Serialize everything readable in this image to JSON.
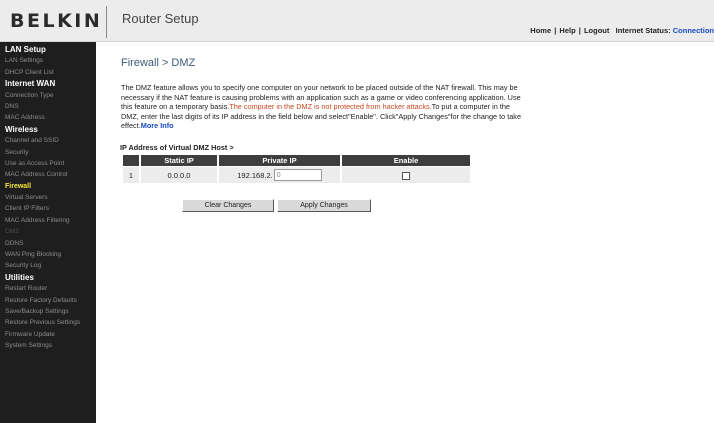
{
  "header": {
    "logo": "BELKIN",
    "title": "Router Setup",
    "links": [
      {
        "label": "Home"
      },
      {
        "label": "Help"
      },
      {
        "label": "Logout"
      }
    ],
    "status_label": "Internet Status:",
    "status_value": "Connection"
  },
  "sidebar": {
    "sections": [
      {
        "title": "LAN Setup",
        "items": [
          "LAN Settings",
          "DHCP Client List"
        ]
      },
      {
        "title": "Internet WAN",
        "items": [
          "Connection Type",
          "DNS",
          "MAC Address"
        ]
      },
      {
        "title": "Wireless",
        "items": [
          "Channel and SSID",
          "Security",
          "Use as Access Point",
          "MAC Address Control"
        ]
      },
      {
        "title": "Firewall",
        "items": [
          "Virtual Servers",
          "Client IP Filters",
          "MAC Address Filtering",
          "DMZ",
          "DDNS",
          "WAN Ping Blocking",
          "Security Log"
        ]
      },
      {
        "title": "Utilities",
        "items": [
          "Restart Router",
          "Restore Factory Defaults",
          "Save/Backup Settings",
          "Restore Previous Settings",
          "Firmware Update",
          "System Settings"
        ]
      }
    ],
    "active_item": "DMZ"
  },
  "main": {
    "page_title": "Firewall > DMZ",
    "description_1": "The DMZ feature allows you to specify one computer on your network to be placed outside of the NAT firewall. This may be necessary if the NAT feature is causing problems with an application such as a game or video conferencing application. Use this feature on a temporary basis.",
    "description_warning": "The computer in the DMZ is not protected from hacker attacks.",
    "description_2": "To put a computer in the DMZ, enter the last digits of its IP address in the field below and select\"Enable\". Click\"Apply Changes\"for the change to take effect.",
    "more_info": "More Info",
    "section_label": "IP Address of Virtual DMZ Host >",
    "table": {
      "headers": [
        "",
        "Static IP",
        "Private IP",
        "Enable"
      ],
      "rows": [
        {
          "num": "1",
          "static_ip": "0.0.0.0",
          "private_ip_prefix": "192.168.2.",
          "private_ip_last": "0",
          "enabled": false
        }
      ]
    },
    "buttons": {
      "clear": "Clear Changes",
      "apply": "Apply Changes"
    }
  },
  "colors": {
    "sidebar_bg": "#1e1e1e",
    "sidebar_heading": "#ffffff",
    "sidebar_highlight": "#f7e33a",
    "link_blue": "#1b49c6",
    "warning": "#c8481f"
  }
}
